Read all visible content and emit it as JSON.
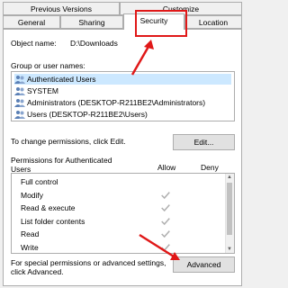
{
  "tabs": {
    "row1": [
      {
        "label": "Previous Versions"
      },
      {
        "label": "Customize"
      }
    ],
    "row2": [
      {
        "label": "General"
      },
      {
        "label": "Sharing"
      },
      {
        "label": "Security",
        "active": true
      },
      {
        "label": "Location"
      }
    ]
  },
  "object": {
    "label": "Object name:",
    "value": "D:\\Downloads"
  },
  "groups": {
    "label": "Group or user names:",
    "items": [
      {
        "label": "Authenticated Users",
        "selected": true
      },
      {
        "label": "SYSTEM"
      },
      {
        "label": "Administrators (DESKTOP-R211BE2\\Administrators)"
      },
      {
        "label": "Users (DESKTOP-R211BE2\\Users)"
      }
    ]
  },
  "change": {
    "text": "To change permissions, click Edit.",
    "button": "Edit..."
  },
  "permissions": {
    "header_line1": "Permissions for Authenticated",
    "header_line2": "Users",
    "allow": "Allow",
    "deny": "Deny",
    "rows": [
      {
        "label": "Full control",
        "allow": false
      },
      {
        "label": "Modify",
        "allow": true
      },
      {
        "label": "Read & execute",
        "allow": true
      },
      {
        "label": "List folder contents",
        "allow": true
      },
      {
        "label": "Read",
        "allow": true
      },
      {
        "label": "Write",
        "allow": true
      }
    ]
  },
  "advanced": {
    "text_line1": "For special permissions or advanced settings,",
    "text_line2": "click Advanced.",
    "button": "Advanced"
  },
  "colors": {
    "annotation": "#e01818",
    "selection": "#cce8ff",
    "check": "#b0b0b0"
  }
}
